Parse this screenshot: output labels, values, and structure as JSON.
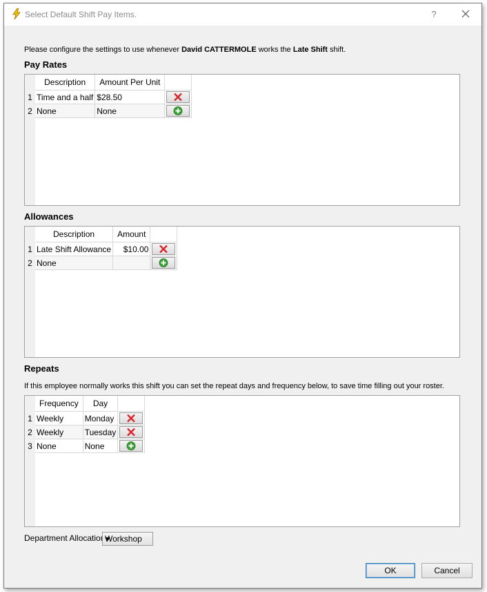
{
  "window": {
    "title": "Select Default Shift Pay Items.",
    "help_label": "?"
  },
  "intro": {
    "prefix": "Please configure the settings to use whenever ",
    "employee": "David CATTERMOLE",
    "middle": " works the ",
    "shift": "Late Shift",
    "suffix": " shift."
  },
  "pay_rates": {
    "heading": "Pay Rates",
    "columns": [
      "Description",
      "Amount Per Unit"
    ],
    "rows": [
      {
        "num": "1",
        "description": "Time and a half",
        "amount": "$28.50",
        "action": "delete"
      },
      {
        "num": "2",
        "description": "None",
        "amount": "None",
        "action": "add"
      }
    ]
  },
  "allowances": {
    "heading": "Allowances",
    "columns": [
      "Description",
      "Amount"
    ],
    "rows": [
      {
        "num": "1",
        "description": "Late Shift Allowance",
        "amount": "$10.00",
        "action": "delete"
      },
      {
        "num": "2",
        "description": "None",
        "amount": "",
        "action": "add"
      }
    ]
  },
  "repeats": {
    "heading": "Repeats",
    "note": "If this employee normally works this shift you can set the repeat days and frequency below, to save time filling out your roster.",
    "columns": [
      "Frequency",
      "Day"
    ],
    "rows": [
      {
        "num": "1",
        "frequency": "Weekly",
        "day": "Monday",
        "action": "delete"
      },
      {
        "num": "2",
        "frequency": "Weekly",
        "day": "Tuesday",
        "action": "delete"
      },
      {
        "num": "3",
        "frequency": "None",
        "day": "None",
        "action": "add"
      }
    ]
  },
  "department": {
    "label": "Department Allocation",
    "selected": "Workshop"
  },
  "buttons": {
    "ok": "OK",
    "cancel": "Cancel"
  },
  "icons": {
    "app": "lightning-icon",
    "delete": "red-x-icon",
    "add": "green-plus-icon"
  },
  "colors": {
    "delete_red": "#d9262b",
    "add_green": "#3aa335",
    "accent_border": "#3c7fb1"
  }
}
